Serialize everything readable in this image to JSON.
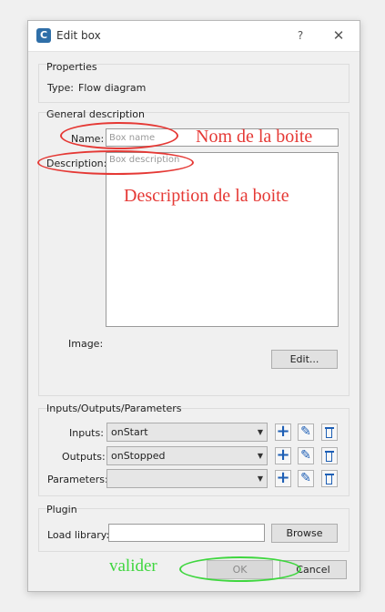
{
  "window": {
    "title": "Edit box",
    "app_icon_letter": "C",
    "help_glyph": "?",
    "close_glyph": "✕"
  },
  "properties": {
    "group_title": "Properties",
    "type_label": "Type:",
    "type_value": "Flow diagram"
  },
  "general": {
    "group_title": "General description",
    "name_label": "Name:",
    "name_value": "",
    "name_placeholder": "Box name",
    "description_label": "Description:",
    "description_value": "",
    "description_placeholder": "Box description",
    "image_label": "Image:",
    "edit_button": "Edit..."
  },
  "io": {
    "group_title": "Inputs/Outputs/Parameters",
    "rows": [
      {
        "label": "Inputs:",
        "value": "onStart"
      },
      {
        "label": "Outputs:",
        "value": "onStopped"
      },
      {
        "label": "Parameters:",
        "value": ""
      }
    ]
  },
  "plugin": {
    "group_title": "Plugin",
    "load_label": "Load library:",
    "load_value": "",
    "browse_button": "Browse"
  },
  "footer": {
    "ok_button": "OK",
    "cancel_button": "Cancel"
  },
  "annotations": {
    "name_note": "Nom de la boite",
    "description_note": "Description de la boite",
    "ok_note": "valider",
    "colors": {
      "red": "#e53935",
      "green": "#3fd63f"
    }
  }
}
